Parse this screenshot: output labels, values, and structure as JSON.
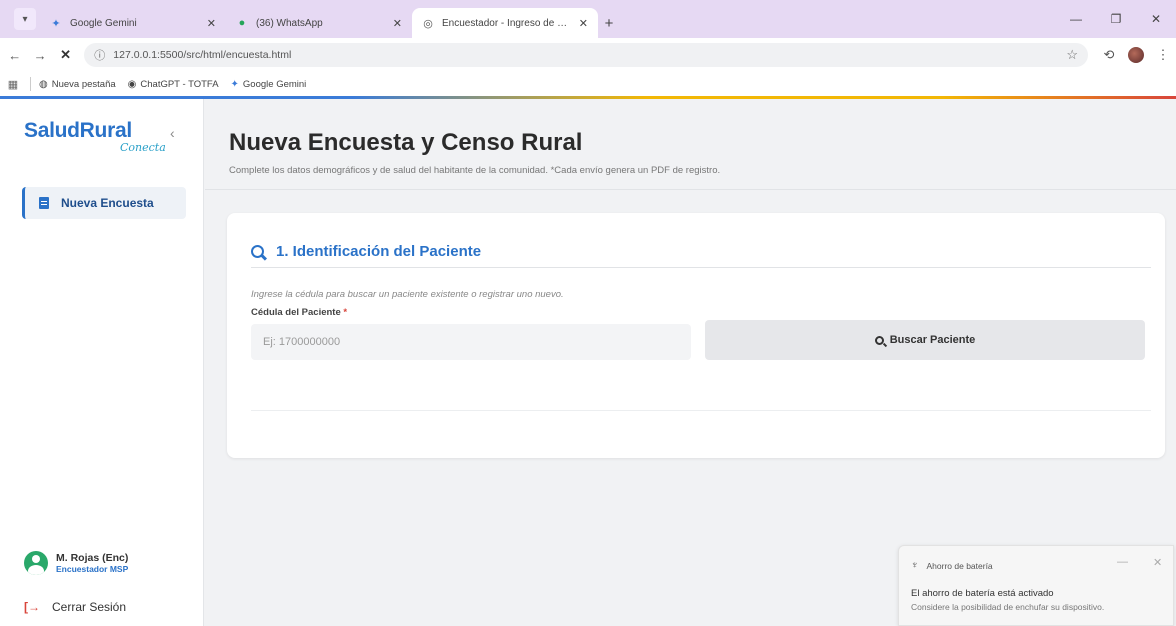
{
  "browser": {
    "tabs": [
      {
        "title": "Google Gemini",
        "icon": "gemini-icon"
      },
      {
        "title": "(36) WhatsApp",
        "icon": "whatsapp-icon"
      },
      {
        "title": "Encuestador - Ingreso de Datos",
        "icon": "page-icon",
        "active": true
      }
    ],
    "new_tab": "+",
    "url": "127.0.0.1:5500/src/html/encuesta.html",
    "bookmarks": [
      "Nueva pestaña",
      "ChatGPT - TOTFA",
      "Google Gemini"
    ]
  },
  "sidebar": {
    "logo_main": "SaludRural",
    "logo_script": "Conecta",
    "nav_item": "Nueva Encuesta",
    "user_name": "M. Rojas (Enc)",
    "user_role": "Encuestador MSP",
    "logout": "Cerrar Sesión"
  },
  "main": {
    "title": "Nueva Encuesta y Censo Rural",
    "subtitle": "Complete los datos demográficos y de salud del habitante de la comunidad. *Cada envío genera un PDF de registro.",
    "section_title": "1. Identificación del Paciente",
    "hint": "Ingrese la cédula para buscar un paciente existente o registrar uno nuevo.",
    "cedula_label": "Cédula del Paciente",
    "cedula_required": "*",
    "cedula_placeholder": "Ej: 1700000000",
    "search_button": "Buscar Paciente"
  },
  "toast": {
    "header": "Ahorro de batería",
    "title": "El ahorro de batería está activado",
    "body": "Considere la posibilidad de enchufar su dispositivo."
  },
  "colors": {
    "primary": "#2a72c8",
    "accent_green": "#2aa86a",
    "danger": "#d8453b",
    "tabbar": "#e6d9f3"
  }
}
